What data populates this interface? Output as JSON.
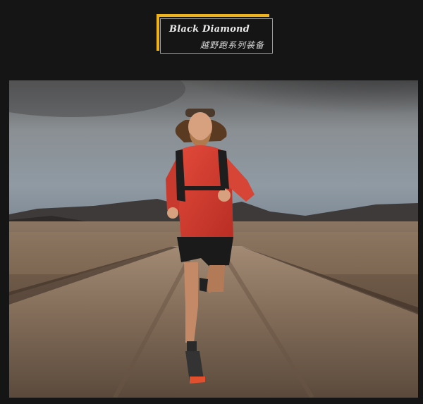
{
  "brand": {
    "name": "Black Diamond",
    "subtitle": "越野跑系列装备",
    "accent_color": "#f0b21a"
  },
  "hero_image": {
    "icon": "trail-runner-photo"
  }
}
